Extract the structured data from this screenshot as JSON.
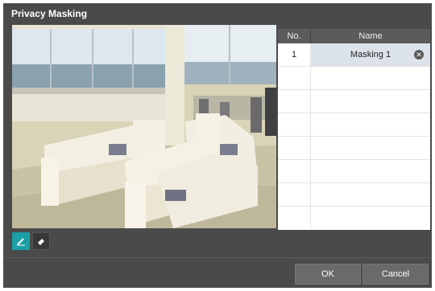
{
  "dialog": {
    "title": "Privacy Masking"
  },
  "table": {
    "headers": {
      "no": "No.",
      "name": "Name"
    },
    "rows": [
      {
        "no": "1",
        "name": "Masking 1",
        "selected": true
      }
    ],
    "empty_row_count": 7
  },
  "tools": [
    {
      "icon": "pencil-icon",
      "active": true
    },
    {
      "icon": "eraser-icon",
      "active": false
    }
  ],
  "buttons": {
    "ok": "OK",
    "cancel": "Cancel"
  },
  "colors": {
    "accent": "#1a9fa6",
    "background": "#4a4a4a",
    "selected_row": "#dde3ea"
  }
}
